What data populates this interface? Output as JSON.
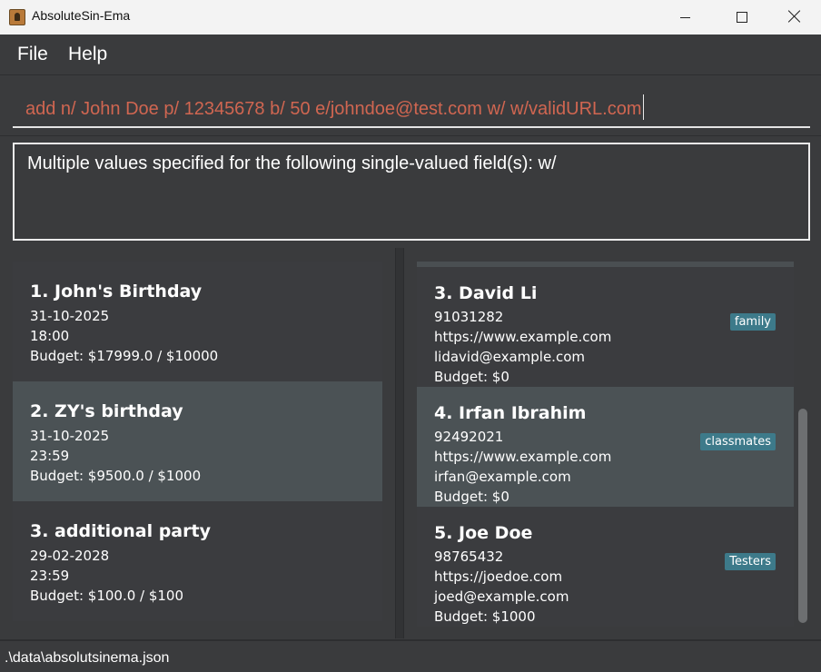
{
  "window": {
    "title": "AbsoluteSin-Ema",
    "controls": {
      "minimize": "minimize",
      "maximize": "maximize",
      "close": "close"
    }
  },
  "menu": {
    "file": "File",
    "help": "Help"
  },
  "command": {
    "value": "add n/ John Doe p/ 12345678 b/ 50 e/johndoe@test.com w/ w/validURL.com"
  },
  "result": {
    "message": "Multiple values specified for the following single-valued field(s): w/"
  },
  "events": [
    {
      "title": "1. John's Birthday",
      "date": "31-10-2025",
      "time": "18:00",
      "budget": "Budget: $17999.0 / $10000"
    },
    {
      "title": "2. ZY's birthday",
      "date": "31-10-2025",
      "time": "23:59",
      "budget": "Budget: $9500.0 / $1000"
    },
    {
      "title": "3. additional party",
      "date": "29-02-2028",
      "time": "23:59",
      "budget": "Budget: $100.0 / $100"
    }
  ],
  "persons": [
    {
      "name": "3. David Li",
      "phone": "91031282",
      "website": "https://www.example.com",
      "email": "lidavid@example.com",
      "budget": "Budget: $0",
      "tag": "family"
    },
    {
      "name": "4. Irfan Ibrahim",
      "phone": "92492021",
      "website": "https://www.example.com",
      "email": "irfan@example.com",
      "budget": "Budget: $0",
      "tag": "classmates"
    },
    {
      "name": "5. Joe Doe",
      "phone": "98765432",
      "website": "https://joedoe.com",
      "email": "joed@example.com",
      "budget": "Budget: $1000",
      "tag": "Testers"
    }
  ],
  "status": {
    "path": ".\\data\\absolutsinema.json"
  },
  "colors": {
    "background": "#3a3b3d",
    "selected_card": "#4b5255",
    "command_text": "#d06651",
    "tag": "#3d7a8a"
  },
  "icons": {
    "app": "app-icon",
    "minimize": "minimize-icon",
    "maximize": "maximize-icon",
    "close": "close-icon"
  }
}
